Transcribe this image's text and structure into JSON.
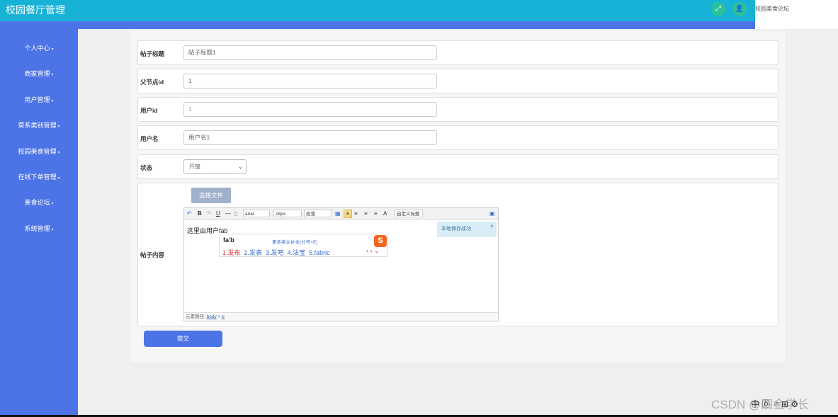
{
  "header": {
    "title": "校园餐厅管理",
    "icons": [
      "fullscreen-icon",
      "user-icon"
    ],
    "link": "校园美食论坛",
    "colors": {
      "topbar": "#17b3d6",
      "strip": "#4d74e6"
    }
  },
  "sidebar": {
    "items": [
      {
        "label": "个人中心"
      },
      {
        "label": "商家管理"
      },
      {
        "label": "用户管理"
      },
      {
        "label": "菜系类别管理"
      },
      {
        "label": "校园美食管理"
      },
      {
        "label": "在线下单管理"
      },
      {
        "label": "美食论坛"
      },
      {
        "label": "系统管理"
      }
    ],
    "caret": "▾"
  },
  "form": {
    "title_label": "帖子标题",
    "title_value": "帖子标题1",
    "parent_label": "父节点id",
    "parent_value": "1",
    "userid_label": "用户id",
    "userid_value": "1",
    "username_label": "用户名",
    "username_value": "用户名1",
    "status_label": "状态",
    "status_value": "开放",
    "content_label": "帖子内容",
    "file_button": "选择文件",
    "submit_label": "提交"
  },
  "editor": {
    "toolbar": {
      "font_family": "arial",
      "font_size": "16px",
      "paragraph": "段落",
      "custom_title": "自定义标题"
    },
    "content_prefix": "这里由用户",
    "content_typed": "fab",
    "notice": "本地保存成功",
    "path_label": "元素路径:",
    "path_body": "body",
    "path_sep": ">",
    "path_p": "p"
  },
  "ime": {
    "input": "fa'b",
    "hint": "更多英文补全(分号+E)",
    "candidates": [
      "1.发布",
      "2.发表",
      "3.发吧",
      "4.法宝",
      "5.fabric"
    ],
    "nav": "‹ › ⌄",
    "logo": "S"
  },
  "watermark": {
    "text": "CSDN @四金学长",
    "tray": "中 ⓪ ♂ ⊞ ⚙"
  }
}
